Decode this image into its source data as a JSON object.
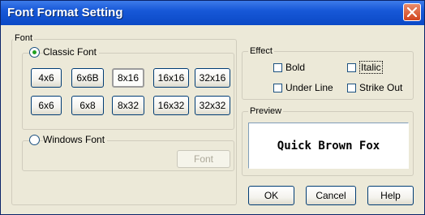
{
  "window": {
    "title": "Font Format Setting"
  },
  "font_group": {
    "legend": "Font",
    "classic_font": {
      "label": "Classic Font",
      "selected": true,
      "sizes_row1": [
        "4x6",
        "6x6B",
        "8x16",
        "16x16",
        "32x16"
      ],
      "sizes_row2": [
        "6x6",
        "6x8",
        "8x32",
        "16x32",
        "32x32"
      ],
      "selected_size": "8x16"
    },
    "windows_font": {
      "label": "Windows Font",
      "selected": false,
      "font_button_label": "Font"
    }
  },
  "effect_group": {
    "legend": "Effect",
    "bold": {
      "label": "Bold",
      "checked": false
    },
    "italic": {
      "label": "Italic",
      "checked": false
    },
    "underline": {
      "label": "Under Line",
      "checked": false
    },
    "strikeout": {
      "label": "Strike Out",
      "checked": false
    }
  },
  "preview_group": {
    "legend": "Preview",
    "text": "Quick Brown Fox"
  },
  "buttons": {
    "ok": "OK",
    "cancel": "Cancel",
    "help": "Help"
  }
}
